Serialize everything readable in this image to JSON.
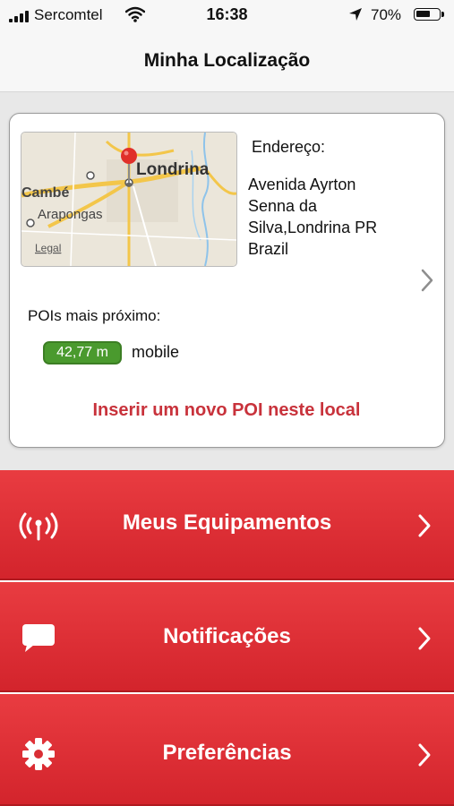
{
  "status_bar": {
    "carrier": "Sercomtel",
    "time": "16:38",
    "battery_percent": "70%",
    "battery_level": 0.7
  },
  "nav": {
    "title": "Minha Localização"
  },
  "location_card": {
    "map": {
      "labels": [
        "Londrina",
        "Cambé",
        "Arapongas"
      ],
      "legal_link": "Legal",
      "pin_color": "#e0302a"
    },
    "address_label": "Endereço:",
    "address_lines": [
      "Avenida Ayrton",
      "Senna da",
      "Silva,Londrina PR",
      "Brazil"
    ],
    "nearest_pois_label": "POIs mais próximo:",
    "nearest_poi": {
      "distance": "42,77 m",
      "name": "mobile"
    },
    "insert_poi_link": "Inserir um novo POI neste local"
  },
  "menu": [
    {
      "label": "Meus Equipamentos",
      "icon": "antenna-icon"
    },
    {
      "label": "Notificações",
      "icon": "chat-bubble-icon"
    },
    {
      "label": "Preferências",
      "icon": "gear-icon"
    }
  ],
  "colors": {
    "accent_red": "#d92e35",
    "link_red": "#c8323b",
    "badge_green": "#4a9a2e"
  }
}
